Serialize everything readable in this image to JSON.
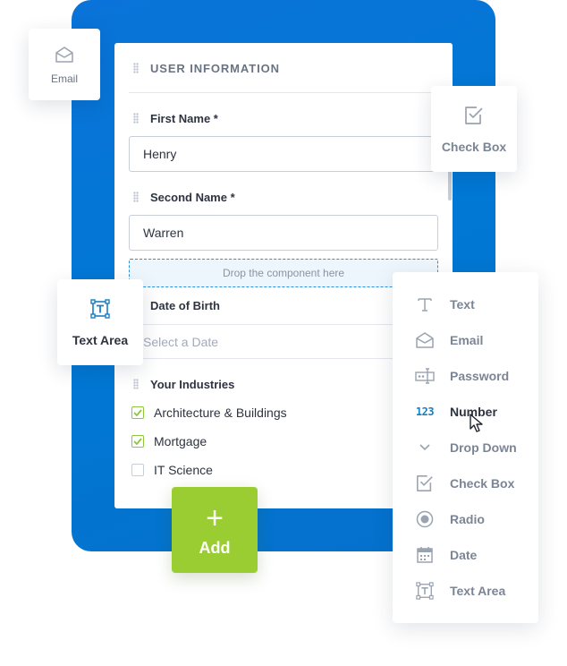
{
  "form": {
    "section_title": "USER INFORMATION",
    "first_name": {
      "label": "First Name *",
      "value": "Henry"
    },
    "second_name": {
      "label": "Second Name *",
      "value": "Warren"
    },
    "drop_zone": "Drop the component here",
    "date_of_birth": {
      "label": "Date of Birth",
      "placeholder": "Select a Date"
    },
    "industries": {
      "label": "Your Industries",
      "options": [
        {
          "label": "Architecture & Buildings",
          "checked": true
        },
        {
          "label": "Mortgage",
          "checked": true
        },
        {
          "label": "IT Science",
          "checked": false
        }
      ]
    }
  },
  "floating": {
    "email_label": "Email",
    "checkbox_label": "Check Box",
    "textarea_label": "Text Area"
  },
  "palette": {
    "items": [
      {
        "icon": "text-icon",
        "label": "Text"
      },
      {
        "icon": "email-icon",
        "label": "Email"
      },
      {
        "icon": "password-icon",
        "label": "Password"
      },
      {
        "icon": "number-icon",
        "label": "Number",
        "glyph": "123",
        "active": true
      },
      {
        "icon": "chevron-down-icon",
        "label": "Drop Down"
      },
      {
        "icon": "checkbox-icon",
        "label": "Check Box"
      },
      {
        "icon": "radio-icon",
        "label": "Radio"
      },
      {
        "icon": "calendar-icon",
        "label": "Date"
      },
      {
        "icon": "text-area-icon",
        "label": "Text Area"
      }
    ]
  },
  "add_button": {
    "label": "Add"
  },
  "colors": {
    "brand_blue": "#0078d4",
    "accent_green": "#9acd32",
    "check_green": "#8dc63f",
    "number_icon_blue": "#1a7ec2"
  }
}
